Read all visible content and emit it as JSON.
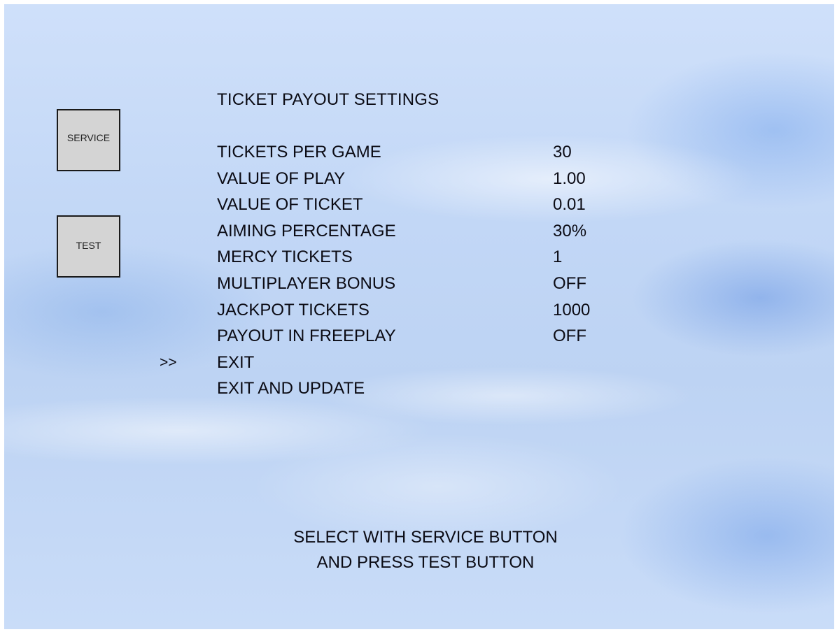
{
  "side_buttons": {
    "service_label": "SERVICE",
    "test_label": "TEST"
  },
  "menu": {
    "title": "TICKET PAYOUT SETTINGS",
    "cursor": ">>",
    "items": [
      {
        "label": "TICKETS PER GAME",
        "value": "30"
      },
      {
        "label": "VALUE OF PLAY",
        "value": "1.00"
      },
      {
        "label": "VALUE OF TICKET",
        "value": "0.01"
      },
      {
        "label": "AIMING PERCENTAGE",
        "value": "30%"
      },
      {
        "label": "MERCY TICKETS",
        "value": "1"
      },
      {
        "label": "MULTIPLAYER BONUS",
        "value": "OFF"
      },
      {
        "label": "JACKPOT TICKETS",
        "value": "1000"
      },
      {
        "label": "PAYOUT IN FREEPLAY",
        "value": "OFF"
      },
      {
        "label": "EXIT",
        "value": ""
      },
      {
        "label": "EXIT AND UPDATE",
        "value": ""
      }
    ],
    "selected_index": 8
  },
  "instructions": {
    "line1": "SELECT WITH SERVICE BUTTON",
    "line2": "AND PRESS TEST BUTTON"
  }
}
